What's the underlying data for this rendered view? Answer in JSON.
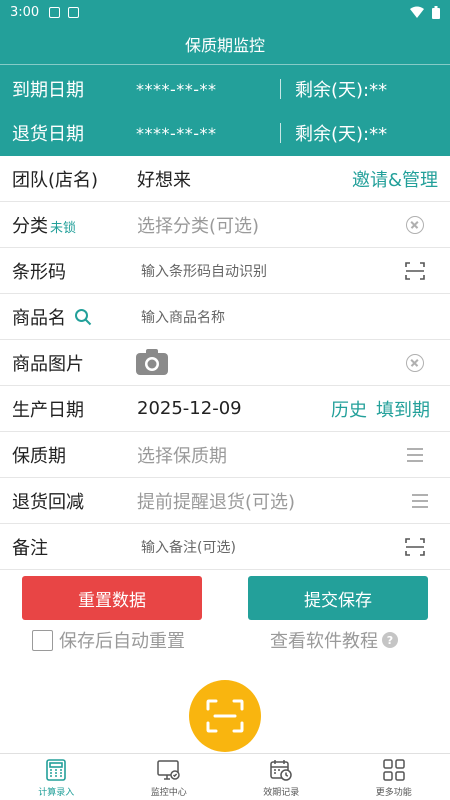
{
  "status_bar": {
    "time": "3:00"
  },
  "header": {
    "title": "保质期监控"
  },
  "summary": {
    "expiry": {
      "label": "到期日期",
      "value": "****-**-**",
      "remaining": "剩余(天):**"
    },
    "return": {
      "label": "退货日期",
      "value": "****-**-**",
      "remaining": "剩余(天):**"
    }
  },
  "form": {
    "team": {
      "label": "团队(店名)",
      "value": "好想来",
      "action": "邀请&管理"
    },
    "category": {
      "label": "分类",
      "lock": "未锁",
      "placeholder": "选择分类(可选)"
    },
    "barcode": {
      "label": "条形码",
      "placeholder": "输入条形码自动识别"
    },
    "product_name": {
      "label": "商品名",
      "placeholder": "输入商品名称"
    },
    "product_image": {
      "label": "商品图片"
    },
    "production_date": {
      "label": "生产日期",
      "value": "2025-12-09",
      "history": "历史",
      "fill_expiry": "填到期"
    },
    "shelf_life": {
      "label": "保质期",
      "placeholder": "选择保质期"
    },
    "return_reduce": {
      "label": "退货回减",
      "placeholder": "提前提醒退货(可选)"
    },
    "note": {
      "label": "备注",
      "placeholder": "输入备注(可选)"
    }
  },
  "actions": {
    "reset": "重置数据",
    "submit": "提交保存",
    "auto_reset": "保存后自动重置",
    "tutorial": "查看软件教程",
    "help_mark": "?"
  },
  "tabs": [
    {
      "label": "计算录入",
      "icon": "calculator-icon",
      "active": true
    },
    {
      "label": "监控中心",
      "icon": "monitor-icon",
      "active": false
    },
    {
      "label": "效期记录",
      "icon": "calendar-clock-icon",
      "active": false
    },
    {
      "label": "更多功能",
      "icon": "grid-icon",
      "active": false
    }
  ],
  "colors": {
    "primary": "#23a09a",
    "danger": "#e84545",
    "fab": "#f9b50f"
  }
}
